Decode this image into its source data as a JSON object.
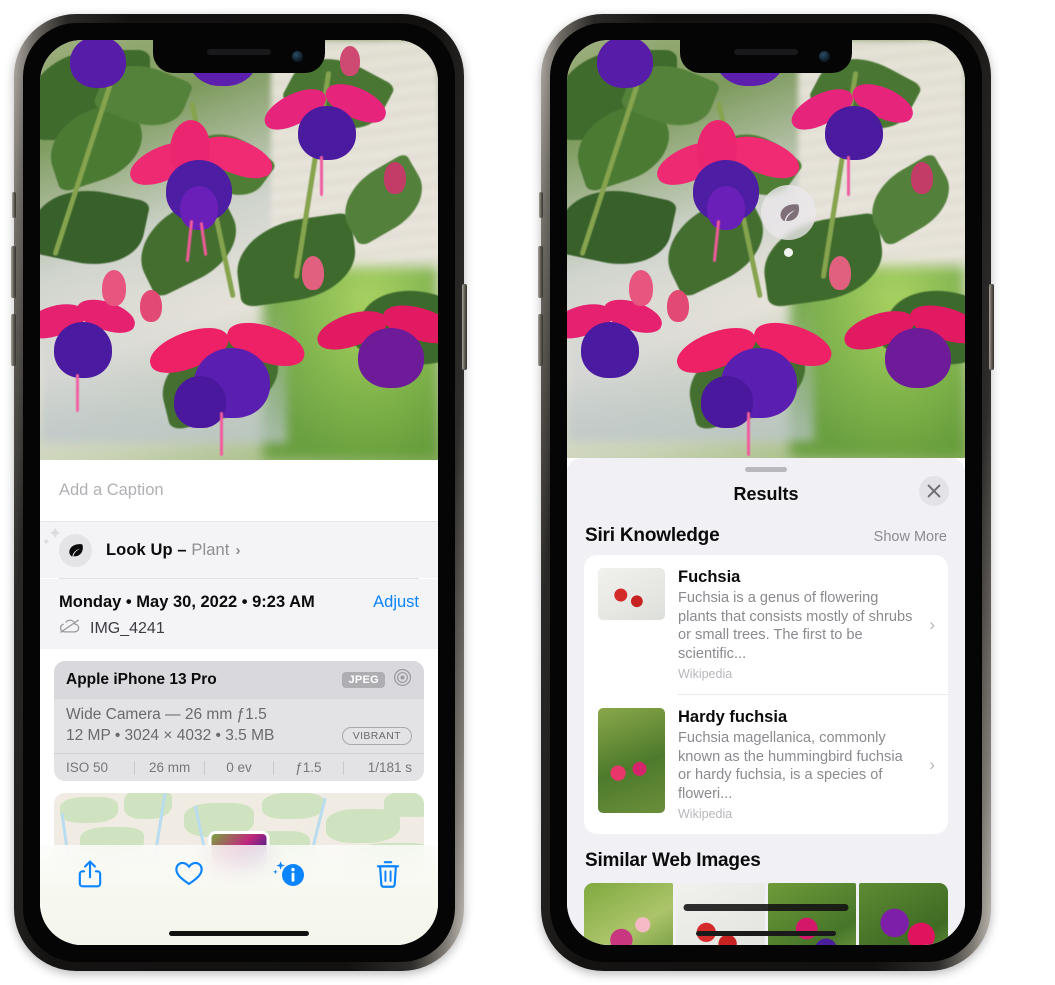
{
  "left_phone": {
    "photo": {
      "alt": "fuchsia-flowers-photo"
    },
    "caption": {
      "placeholder": "Add a Caption",
      "value": ""
    },
    "lookup": {
      "label": "Look Up –",
      "subject": "Plant",
      "icon": "leaf-icon",
      "chevron": "›"
    },
    "info": {
      "date": "Monday • May 30, 2022 • 9:23 AM",
      "adjust_label": "Adjust",
      "filename": "IMG_4241",
      "cloud_icon": "icloud-slash-icon"
    },
    "camera": {
      "model": "Apple iPhone 13 Pro",
      "format_badge": "JPEG",
      "aperture_icon": "aperture-icon",
      "lens_line": "Wide Camera — 26 mm ƒ1.5",
      "specs_line": "12 MP • 3024 × 4032 • 3.5 MB",
      "style_badge": "VIBRANT",
      "exif": [
        "ISO 50",
        "26 mm",
        "0 ev",
        "ƒ1.5",
        "1/181 s"
      ]
    },
    "map": {
      "pin_alt": "photo-location-pin"
    },
    "toolbar": [
      {
        "name": "share-button",
        "icon": "share-icon"
      },
      {
        "name": "favorite-button",
        "icon": "heart-icon"
      },
      {
        "name": "info-button",
        "icon": "info-sparkle-icon"
      },
      {
        "name": "delete-button",
        "icon": "trash-icon"
      }
    ],
    "accent_color": "#0a84ff"
  },
  "right_phone": {
    "visual_lookup_badge": {
      "icon": "leaf-icon"
    },
    "sheet": {
      "title": "Results",
      "close_icon": "close-icon",
      "grabber": "sheet-grabber"
    },
    "siri_knowledge": {
      "title": "Siri Knowledge",
      "show_more": "Show More",
      "entries": [
        {
          "title": "Fuchsia",
          "description": "Fuchsia is a genus of flowering plants that consists mostly of shrubs or small trees. The first to be scientific...",
          "source": "Wikipedia",
          "chevron": "›"
        },
        {
          "title": "Hardy fuchsia",
          "description": "Fuchsia magellanica, commonly known as the hummingbird fuchsia or hardy fuchsia, is a species of floweri...",
          "source": "Wikipedia",
          "chevron": "›"
        }
      ]
    },
    "similar_web_images": {
      "title": "Similar Web Images",
      "images": [
        "fuchsia-web-image-1",
        "fuchsia-web-image-2",
        "fuchsia-web-image-3",
        "fuchsia-web-image-4"
      ]
    }
  }
}
